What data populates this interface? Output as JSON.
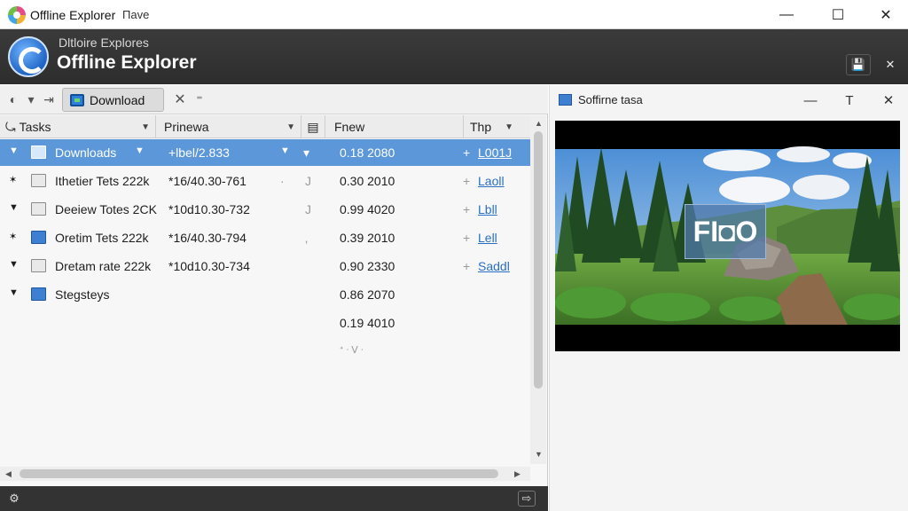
{
  "window": {
    "title": "Offline Explorer",
    "title_extra": "Пave",
    "controls": {
      "minimize": "—",
      "maximize": "☐",
      "close": "✕"
    }
  },
  "banner": {
    "subtitle": "Dltloire Explores",
    "title": "Offline Explorer",
    "save_icon": "💾",
    "close_icon": "✕"
  },
  "toolbar": {
    "download_label": "Download",
    "close_icon": "✕",
    "overflow_icon": "⁼",
    "nav_icons": [
      "◐",
      "▾",
      "⇥"
    ]
  },
  "columns": [
    {
      "label": "Tasks",
      "icon": "⤿"
    },
    {
      "label": "Prinewa"
    },
    {
      "label": "▤"
    },
    {
      "label": "Fnew"
    },
    {
      "label": "Thp"
    }
  ],
  "rows": [
    {
      "expander": "▼",
      "icon": "doc",
      "name": "Downloads",
      "name_dd": "▼",
      "col2": "+lbel/2.833",
      "col2_dd": "▼",
      "col3": "▾",
      "col4": "0.18 2080",
      "col5_prefix": "+",
      "col5": "L001J",
      "selected": true
    },
    {
      "expander": "✶",
      "icon": "doc",
      "name": "Ithetier Tets 222k",
      "col2": "*16/40.30-761",
      "col3": "J",
      "col4": "0.30 2010",
      "col5_prefix": "+",
      "col5": "Laoll",
      "selected": false
    },
    {
      "expander": "▼",
      "icon": "doc",
      "name": "Deeiew Totes 2CK",
      "col2": "*10d10.30-732",
      "col3": "J",
      "col4": "0.99 4020",
      "col5_prefix": "+",
      "col5": "Lbll",
      "selected": false
    },
    {
      "expander": "✶",
      "icon": "blue",
      "name": "Oretim Tets 222k",
      "col2": "*16/40.30-794",
      "col3": "‚",
      "col4": "0.39 2010",
      "col5_prefix": "+",
      "col5": "Lell",
      "selected": false
    },
    {
      "expander": "▼",
      "icon": "doc",
      "name": "Dretam rate 222k",
      "col2": "*10d10.30-734",
      "col3": "",
      "col4": "0.90 2330",
      "col5_prefix": "+",
      "col5": "Saddl",
      "selected": false
    },
    {
      "expander": "▼",
      "icon": "blue",
      "name": "Stegsteys",
      "col2": "",
      "col3": "",
      "col4": "0.86 2070",
      "col5_prefix": "",
      "col5": "",
      "selected": false
    },
    {
      "expander": "",
      "icon": "",
      "name": "",
      "col2": "",
      "col3": "",
      "col4": "0.19 4010",
      "col5_prefix": "",
      "col5": "",
      "selected": false
    },
    {
      "expander": "",
      "icon": "",
      "name": "",
      "col2": "",
      "col3": "",
      "col4": "ᐩ ᐧ ᐯ ᐧ",
      "col5_prefix": "",
      "col5": "",
      "selected": false
    }
  ],
  "preview_panel": {
    "title": "Soffirne tasa",
    "controls": {
      "minimize": "—",
      "pin": "T",
      "close": "✕"
    },
    "badge_text": "FI◘O"
  },
  "statusbar": {
    "left_icon": "⚙",
    "right_icon": "⇨"
  }
}
